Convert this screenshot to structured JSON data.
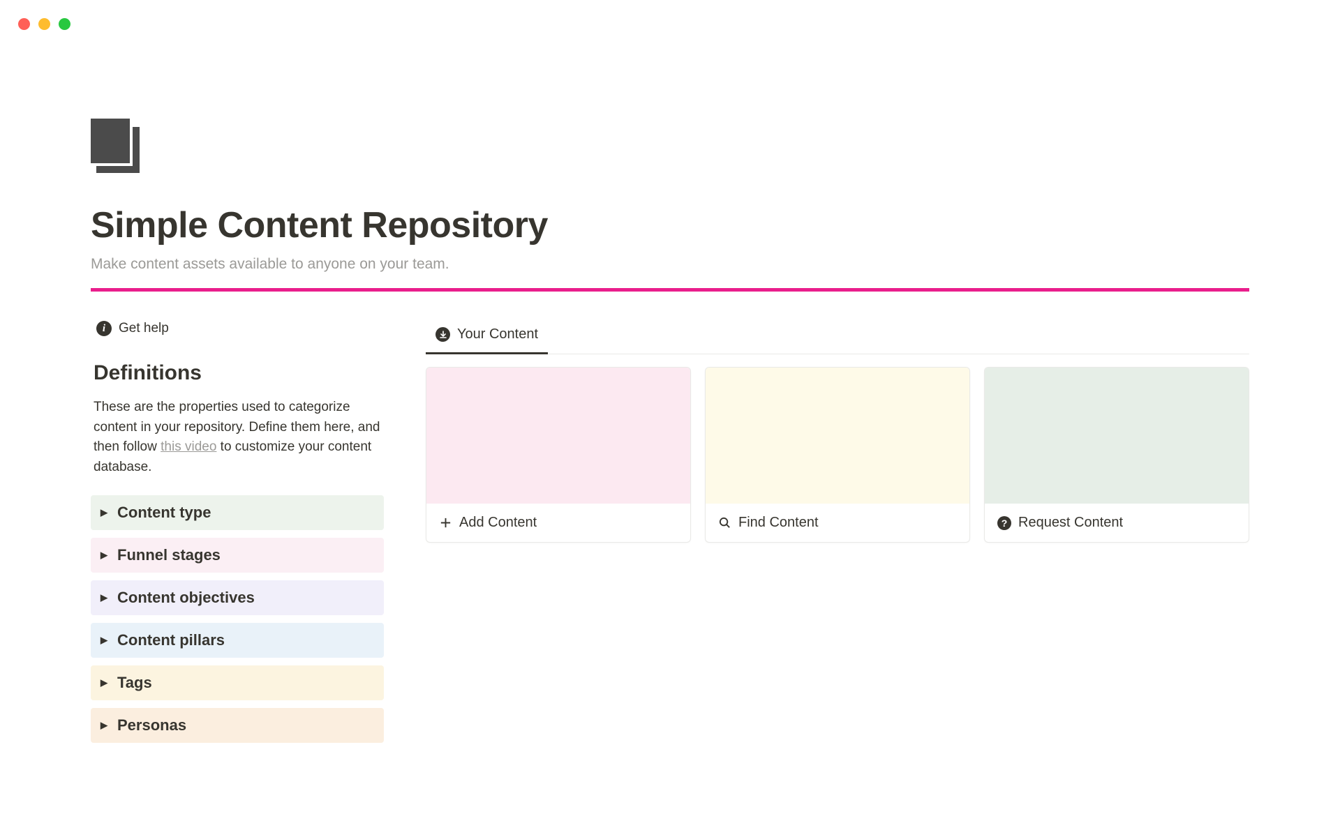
{
  "page": {
    "title": "Simple Content Repository",
    "subtitle": "Make content assets available to anyone on your team."
  },
  "left": {
    "get_help": "Get help",
    "definitions_heading": "Definitions",
    "definitions_text_before": "These are the properties used to categorize content in your repository. Define them here, and then follow ",
    "definitions_link": "this video",
    "definitions_text_after": " to customize your content database.",
    "items": [
      {
        "label": "Content type"
      },
      {
        "label": "Funnel stages"
      },
      {
        "label": "Content objectives"
      },
      {
        "label": "Content pillars"
      },
      {
        "label": "Tags"
      },
      {
        "label": "Personas"
      }
    ]
  },
  "right": {
    "tab_label": "Your Content",
    "cards": [
      {
        "label": "Add Content"
      },
      {
        "label": "Find Content"
      },
      {
        "label": "Request Content"
      }
    ]
  }
}
